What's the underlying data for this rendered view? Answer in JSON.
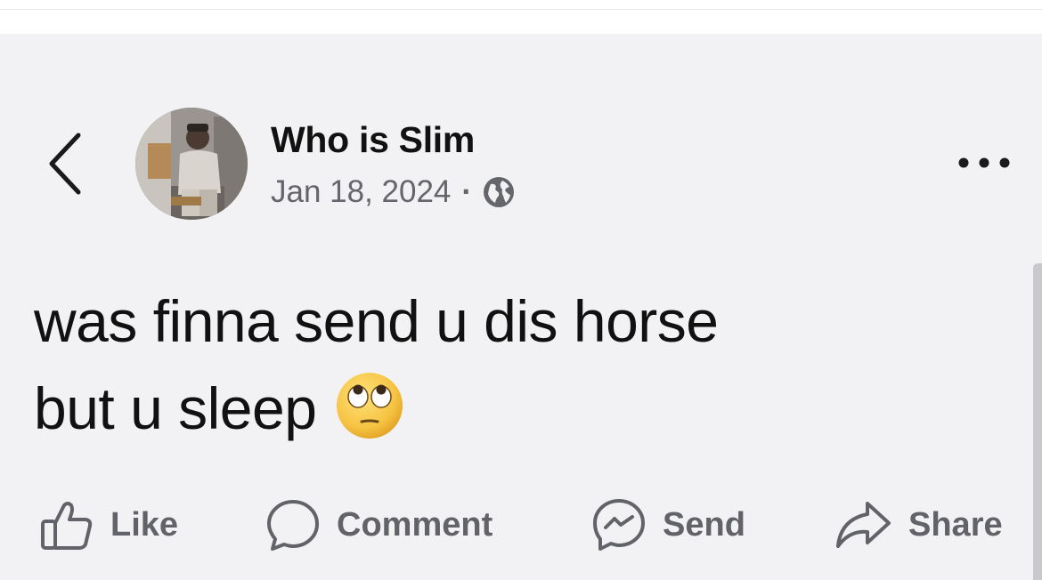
{
  "post": {
    "author": {
      "name": "Who is Slim",
      "avatar_icon": "profile-photo"
    },
    "meta": {
      "date": "Jan 18, 2024",
      "separator": "·",
      "audience_icon": "globe-icon"
    },
    "text": {
      "line1": "was finna send u dis horse",
      "line2": "but u sleep",
      "emoji": "face-with-rolling-eyes"
    }
  },
  "actions": {
    "like": "Like",
    "comment": "Comment",
    "send": "Send",
    "share": "Share"
  },
  "icons": {
    "back": "chevron-left-icon",
    "more": "more-dots-icon"
  },
  "colors": {
    "background": "#f2f1f4",
    "text": "#111111",
    "muted": "#65666b",
    "action": "#626368"
  }
}
